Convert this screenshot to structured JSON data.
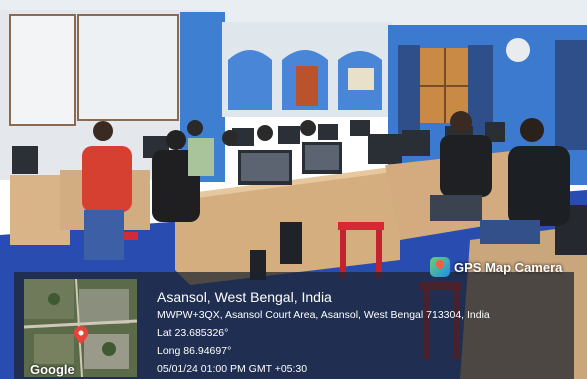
{
  "photo": {
    "description_icon": "computer-lab-photo"
  },
  "watermark": {
    "app_name": "GPS Map Camera",
    "app_icon": "map-pin-icon",
    "map_provider": "Google",
    "location_title": "Asansol, West Bengal, India",
    "address": "MWPW+3QX, Asansol Court Area, Asansol, West Bengal 713304, India",
    "latitude": "Lat 23.685326°",
    "longitude": "Long 86.94697°",
    "timestamp": "05/01/24 01:00 PM GMT +05:30",
    "pin_color": "#e8433a"
  }
}
